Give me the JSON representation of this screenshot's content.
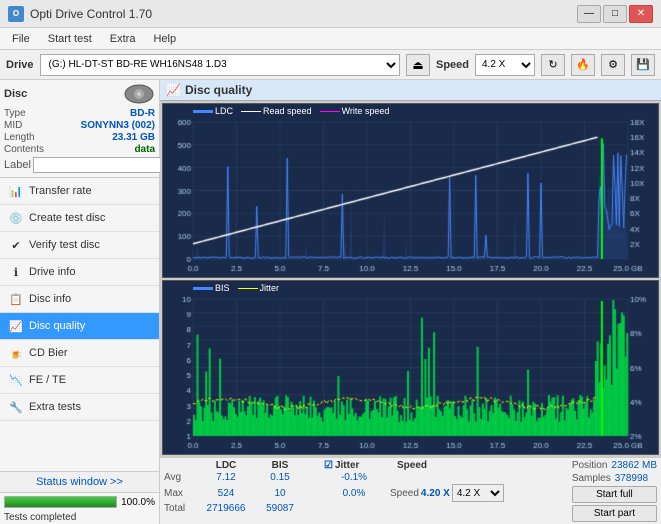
{
  "titleBar": {
    "title": "Opti Drive Control 1.70",
    "minimize": "—",
    "maximize": "□",
    "close": "✕"
  },
  "menuBar": {
    "items": [
      "File",
      "Start test",
      "Extra",
      "Help"
    ]
  },
  "driveBar": {
    "label": "Drive",
    "driveValue": "(G:)  HL-DT-ST BD-RE  WH16NS48 1.D3",
    "ejectSymbol": "⏏",
    "speedLabel": "Speed",
    "speedValue": "4.2 X"
  },
  "discPanel": {
    "label": "Disc",
    "typeLabel": "Type",
    "typeValue": "BD-R",
    "midLabel": "MID",
    "midValue": "SONYNN3 (002)",
    "lengthLabel": "Length",
    "lengthValue": "23.31 GB",
    "contentsLabel": "Contents",
    "contentsValue": "data",
    "labelLabel": "Label",
    "labelValue": ""
  },
  "navItems": [
    {
      "id": "transfer-rate",
      "label": "Transfer rate",
      "icon": "📊"
    },
    {
      "id": "create-test-disc",
      "label": "Create test disc",
      "icon": "💿"
    },
    {
      "id": "verify-test-disc",
      "label": "Verify test disc",
      "icon": "✔"
    },
    {
      "id": "drive-info",
      "label": "Drive info",
      "icon": "ℹ"
    },
    {
      "id": "disc-info",
      "label": "Disc info",
      "icon": "📋"
    },
    {
      "id": "disc-quality",
      "label": "Disc quality",
      "icon": "📈",
      "active": true
    },
    {
      "id": "cd-bier",
      "label": "CD Bier",
      "icon": "🍺"
    },
    {
      "id": "fe-te",
      "label": "FE / TE",
      "icon": "📉"
    },
    {
      "id": "extra-tests",
      "label": "Extra tests",
      "icon": "🔧"
    }
  ],
  "status": {
    "windowBtn": "Status window >>",
    "statusText": "Tests completed",
    "progressPercent": 100
  },
  "discQuality": {
    "title": "Disc quality",
    "chartLegend": {
      "ldc": "LDC",
      "readSpeed": "Read speed",
      "writeSpeed": "Write speed"
    },
    "chart2Legend": {
      "bis": "BIS",
      "jitter": "Jitter"
    },
    "stats": {
      "headers": [
        "LDC",
        "BIS",
        "",
        "Jitter",
        "Speed",
        ""
      ],
      "avgLabel": "Avg",
      "avgLdc": "7.12",
      "avgBis": "0.15",
      "avgJitter": "-0.1%",
      "maxLabel": "Max",
      "maxLdc": "524",
      "maxBis": "10",
      "maxJitter": "0.0%",
      "totalLabel": "Total",
      "totalLdc": "2719666",
      "totalBis": "59087",
      "speedLabel": "Speed",
      "speedValue": "4.20 X",
      "speedDropdown": "4.2 X",
      "posLabel": "Position",
      "posValue": "23862 MB",
      "samplesLabel": "Samples",
      "samplesValue": "378998",
      "startFull": "Start full",
      "startPart": "Start part",
      "jitterChecked": true,
      "jitterLabel": "Jitter"
    },
    "xAxisMax": "25.0 GB",
    "yAxisMaxTop": 600,
    "yAxisMaxBottom": 10
  }
}
